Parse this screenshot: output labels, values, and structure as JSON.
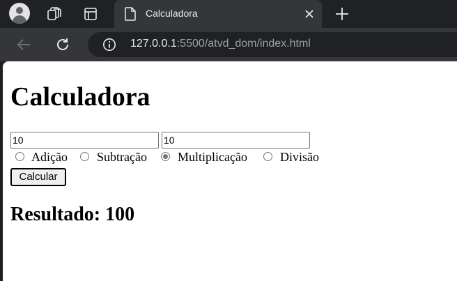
{
  "browser": {
    "tab": {
      "title": "Calculadora",
      "favicon": "document-icon"
    },
    "address_bar": {
      "host": "127.0.0.1",
      "path": ":5500/atvd_dom/index.html"
    },
    "icons": {
      "profile": "profile-avatar-icon",
      "tab_actions": "tab-actions-icon",
      "tab_search": "tab-groups-icon",
      "close_tab": "close-icon",
      "new_tab": "plus-icon",
      "back": "back-arrow-icon",
      "reload": "reload-icon",
      "site_info": "info-icon"
    },
    "colors": {
      "tabstrip_bg": "#202124",
      "active_tab_bg": "#35363a",
      "omnibox_bg": "#202124",
      "text_light": "#e8eaed",
      "text_dim": "#9aa0a6"
    }
  },
  "page": {
    "heading": "Calculadora",
    "inputs": {
      "first_value": "10",
      "second_value": "10"
    },
    "operations": [
      {
        "label": "Adição",
        "checked": false
      },
      {
        "label": "Subtração",
        "checked": false
      },
      {
        "label": "Multiplicação",
        "checked": true
      },
      {
        "label": "Divisão",
        "checked": false
      }
    ],
    "calculate_button": "Calcular",
    "result_text": "Resultado: 100"
  }
}
